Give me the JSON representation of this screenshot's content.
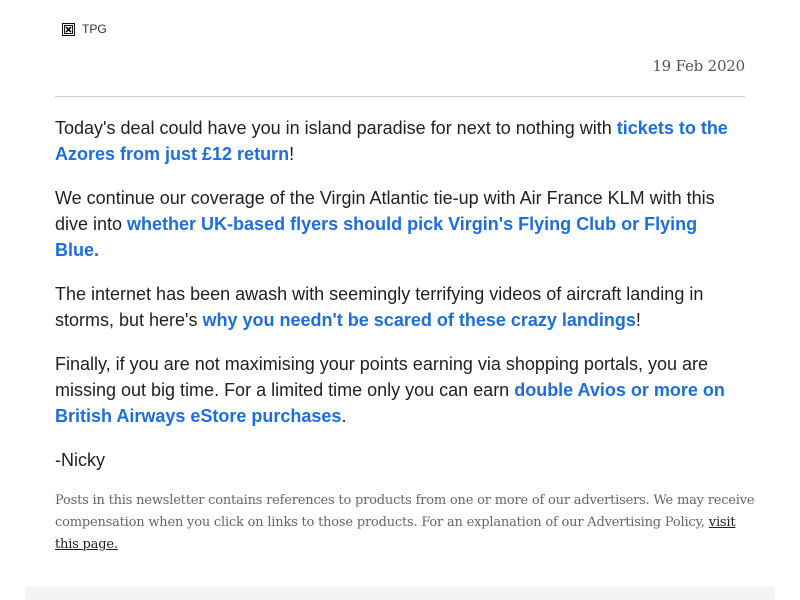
{
  "header": {
    "logo_alt": "TPG",
    "logo_icon": "broken-image-icon",
    "date": "19 Feb 2020"
  },
  "paragraphs": [
    {
      "before": "Today's deal could have you in island paradise for next to nothing with ",
      "link": "tickets to the Azores from just £12 return",
      "after": "!"
    },
    {
      "before": "We continue our coverage of the Virgin Atlantic tie-up with Air France KLM with this dive into ",
      "link": "whether UK-based flyers should pick Virgin's Flying Club or Flying Blue.",
      "after": ""
    },
    {
      "before": "The internet has been awash with seemingly terrifying videos of aircraft landing in storms, but here's ",
      "link": "why you needn't be scared of these crazy landings",
      "after": "!"
    },
    {
      "before": "Finally, if you are not maximising your points earning via shopping portals, you are missing out big time. For a limited time only you can earn ",
      "link": "double Avios or more on British Airways eStore purchases",
      "after": "."
    }
  ],
  "signature": "-Nicky",
  "disclaimer": {
    "text": "Posts in this newsletter contains references to products from one or more of our advertisers. We may receive compensation when you click on links to those products. For an explanation of our Advertising Policy, ",
    "link": "visit this page."
  },
  "colors": {
    "link": "#1d6ee0",
    "text": "#222222",
    "muted": "#666666",
    "divider": "#c8cfd6"
  }
}
